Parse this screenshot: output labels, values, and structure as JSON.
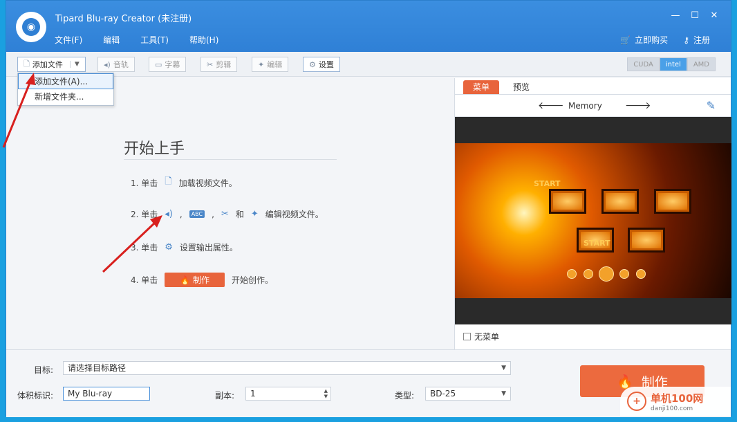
{
  "app": {
    "title": "Tipard Blu-ray Creator (未注册)",
    "menus": [
      "文件(F)",
      "编辑",
      "工具(T)",
      "帮助(H)"
    ],
    "buy_label": "立即购买",
    "register_label": "注册"
  },
  "toolbar": {
    "add_file": "添加文件",
    "audio": "音轨",
    "subtitle": "字幕",
    "clip": "剪辑",
    "edit": "编辑",
    "settings": "设置",
    "gpu": [
      "CUDA",
      "intel",
      "AMD"
    ]
  },
  "add_menu": {
    "items": [
      "添加文件(A)...",
      "新增文件夹..."
    ]
  },
  "getting_started": {
    "title": "开始上手",
    "step1_prefix": "1. 单击",
    "step1_text": "加载视频文件。",
    "step2_prefix": "2. 单击",
    "step2_sep1": ",",
    "abc_text": "ABC",
    "step2_sep2": ",",
    "step2_and": "和",
    "step2_text": "编辑视频文件。",
    "step3_prefix": "3. 单击",
    "step3_text": "设置输出属性。",
    "step4_prefix": "4. 单击",
    "step4_button": "制作",
    "step4_text": "开始创作。"
  },
  "menu_panel": {
    "tabs": [
      "菜单",
      "预览"
    ],
    "template_name": "Memory",
    "start_text_1": "START",
    "start_text_2": "START",
    "no_menu_label": "无菜单"
  },
  "output": {
    "target_label": "目标:",
    "target_placeholder": "请选择目标路径",
    "volume_label": "体积标识:",
    "volume_value": "My Blu-ray",
    "copies_label": "副本:",
    "copies_value": "1",
    "type_label": "类型:",
    "type_value": "BD-25",
    "make_button": "制作"
  },
  "watermark": {
    "site_name": "单机100网",
    "site_url": "danji100.com"
  }
}
